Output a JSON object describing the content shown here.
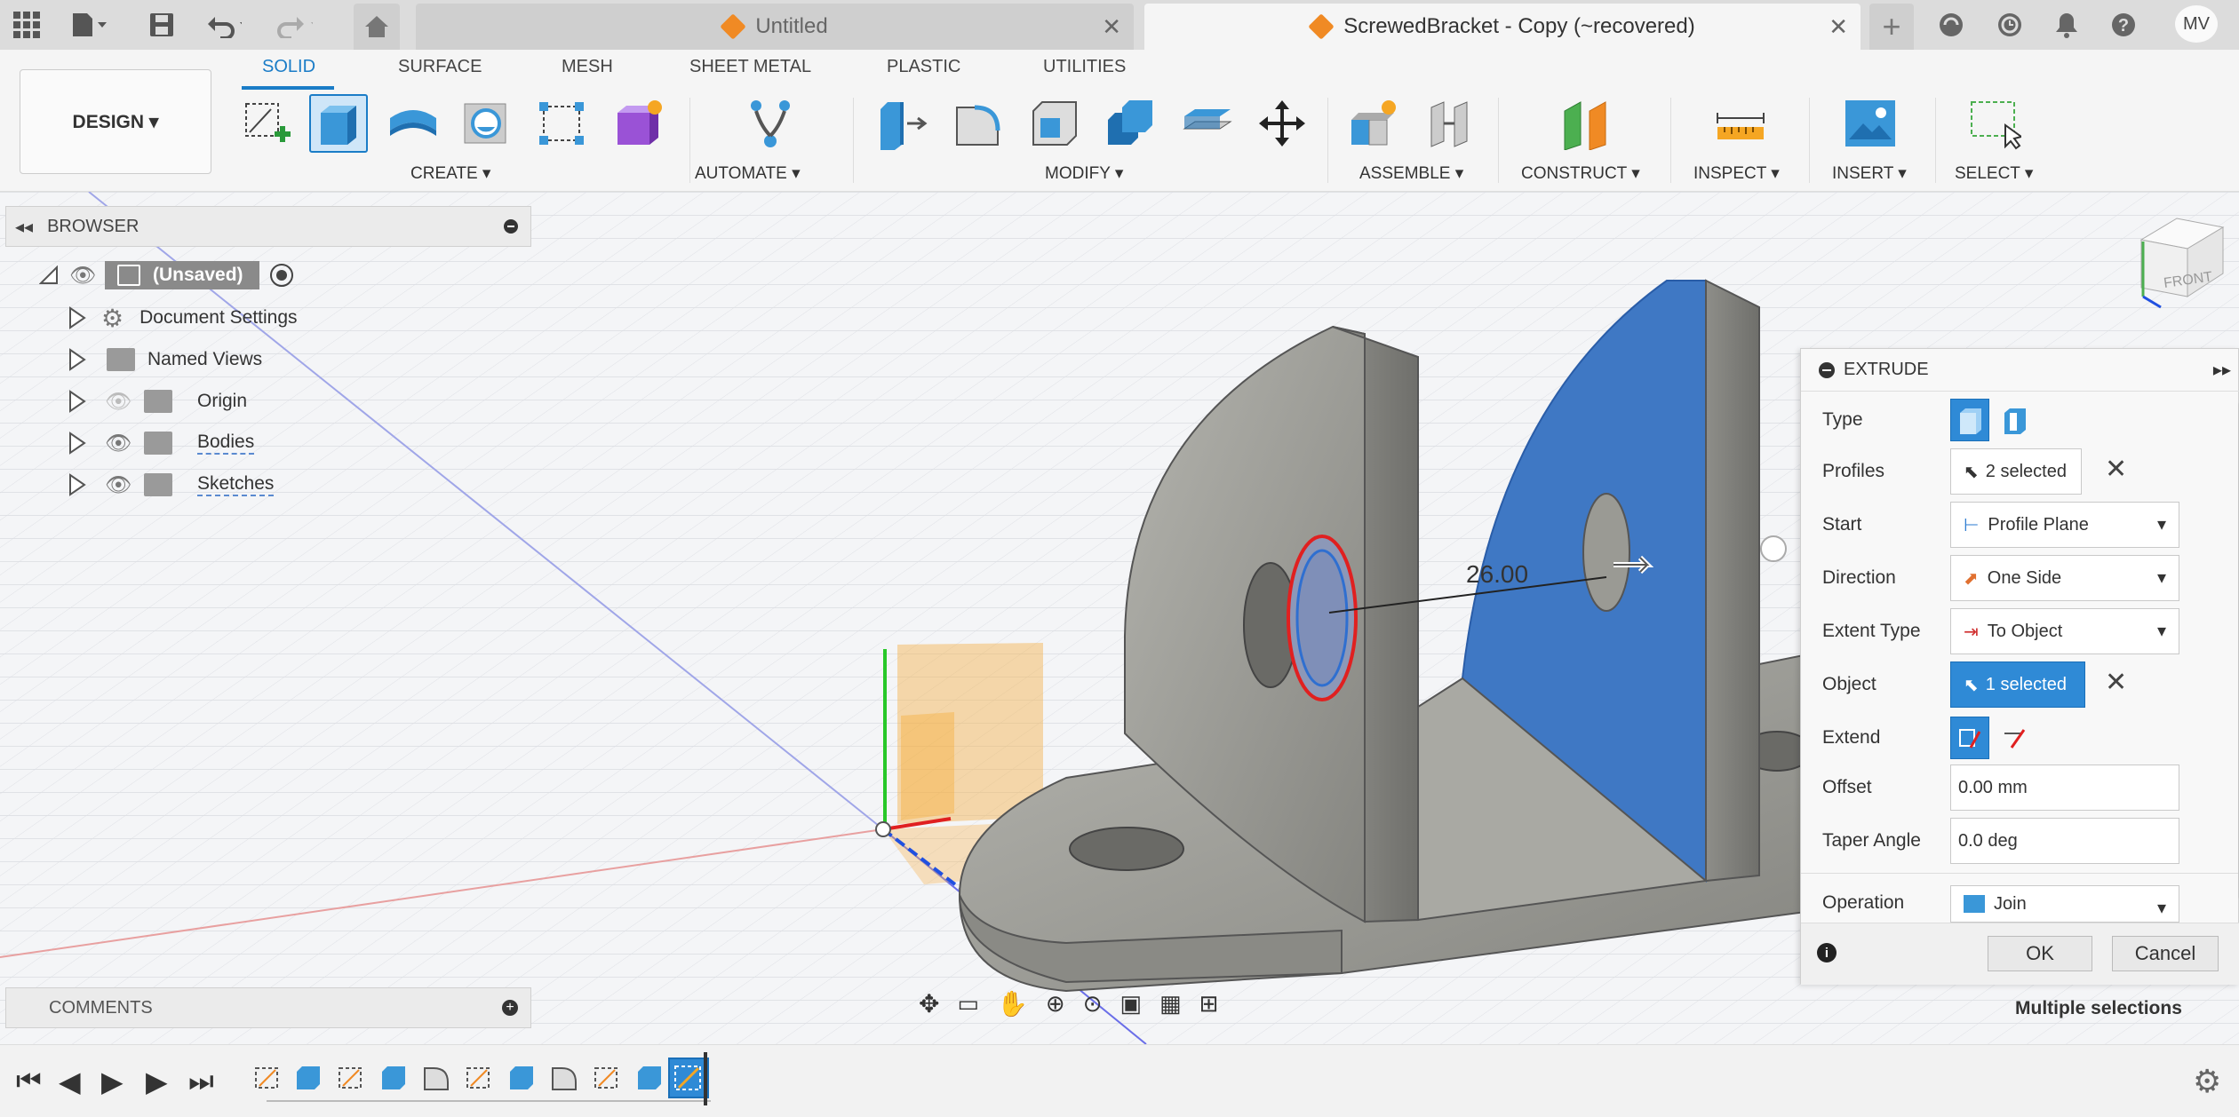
{
  "tabs": {
    "untitled": "Untitled",
    "active": "ScrewedBracket - Copy (~recovered)"
  },
  "user_initials": "MV",
  "ribbon": {
    "workspace": "DESIGN ▾",
    "tabs": [
      "SOLID",
      "SURFACE",
      "MESH",
      "SHEET METAL",
      "PLASTIC",
      "UTILITIES"
    ],
    "groups": [
      "CREATE ▾",
      "AUTOMATE ▾",
      "MODIFY ▾",
      "ASSEMBLE ▾",
      "CONSTRUCT ▾",
      "INSPECT ▾",
      "INSERT ▾",
      "SELECT ▾"
    ]
  },
  "browser": {
    "title": "BROWSER",
    "root": "(Unsaved)",
    "items": [
      "Document Settings",
      "Named Views",
      "Origin",
      "Bodies",
      "Sketches"
    ]
  },
  "viewport": {
    "dimension": "26.00",
    "viewcube_label": "FRONT",
    "status": "Multiple selections"
  },
  "extrude": {
    "title": "EXTRUDE",
    "type_label": "Type",
    "profiles_label": "Profiles",
    "profiles_value": "2 selected",
    "start_label": "Start",
    "start_value": "Profile Plane",
    "direction_label": "Direction",
    "direction_value": "One Side",
    "extent_label": "Extent Type",
    "extent_value": "To Object",
    "object_label": "Object",
    "object_value": "1 selected",
    "extend_label": "Extend",
    "offset_label": "Offset",
    "offset_value": "0.00 mm",
    "taper_label": "Taper Angle",
    "taper_value": "0.0 deg",
    "operation_label": "Operation",
    "operation_value": "Join",
    "ok": "OK",
    "cancel": "Cancel"
  },
  "comments": {
    "title": "COMMENTS"
  },
  "colors": {
    "accent": "#1a7cc7",
    "selected_face": "#3f78c4",
    "body": "#9c9c96",
    "plane": "#f5b24a"
  }
}
